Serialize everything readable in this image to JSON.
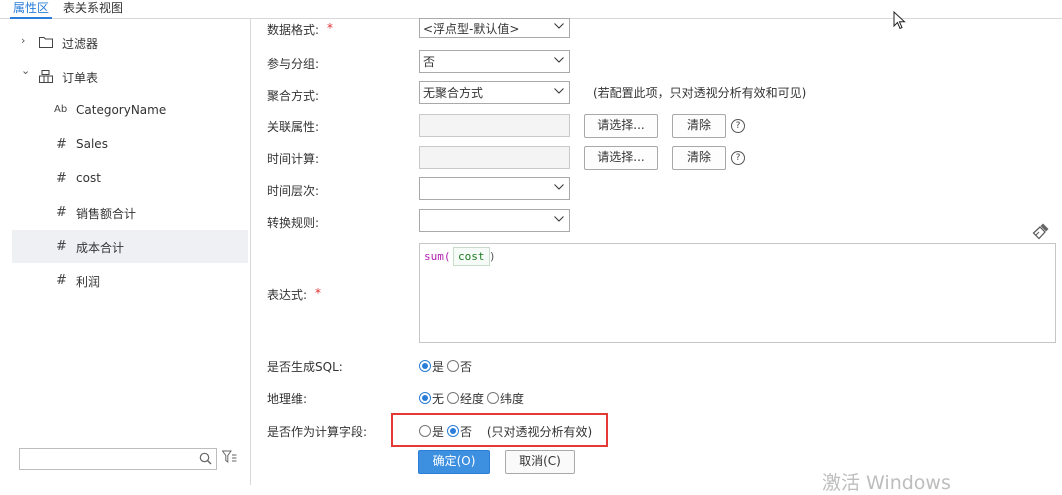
{
  "tabs": [
    {
      "label": "属性区",
      "active": true
    },
    {
      "label": "表关系视图",
      "active": false
    }
  ],
  "tree": {
    "items": [
      {
        "label": "过滤器",
        "icon": "folder-icon",
        "expander": "›"
      },
      {
        "label": "订单表",
        "icon": "table-icon",
        "expander": "⌄"
      },
      {
        "label": "CategoryName",
        "icon": "text-field-icon",
        "icon_glyph": "Ab"
      },
      {
        "label": "Sales",
        "icon": "number-field-icon",
        "icon_glyph": "#"
      },
      {
        "label": "cost",
        "icon": "number-field-icon",
        "icon_glyph": "#"
      },
      {
        "label": "销售额合计",
        "icon": "number-field-icon",
        "icon_glyph": "#"
      },
      {
        "label": "成本合计",
        "icon": "number-field-icon",
        "icon_glyph": "#",
        "selected": true
      },
      {
        "label": "利润",
        "icon": "number-field-icon",
        "icon_glyph": "#"
      }
    ],
    "search": {
      "value": "",
      "placeholder": ""
    }
  },
  "form": {
    "data_format": {
      "label": "数据格式:",
      "value": "<浮点型-默认值>"
    },
    "group": {
      "label": "参与分组:",
      "value": "否"
    },
    "aggregation": {
      "label": "聚合方式:",
      "value": "无聚合方式",
      "note": "(若配置此项，只对透视分析有效和可见)"
    },
    "related_attr": {
      "label": "关联属性:",
      "choose": "请选择...",
      "clear": "清除",
      "help": "?"
    },
    "time_calc": {
      "label": "时间计算:",
      "choose": "请选择...",
      "clear": "清除",
      "help": "?"
    },
    "time_level": {
      "label": "时间层次:",
      "value": ""
    },
    "conversion": {
      "label": "转换规则:",
      "value": ""
    },
    "expression": {
      "label": "表达式:",
      "required": "*",
      "fn": "sum(",
      "arg": "cost",
      "close": ")"
    },
    "gen_sql": {
      "label": "是否生成SQL:",
      "options": [
        "是",
        "否"
      ],
      "selected": 0
    },
    "geo": {
      "label": "地理维:",
      "options": [
        "无",
        "经度",
        "纬度"
      ],
      "selected": 0
    },
    "calc_field": {
      "label": "是否作为计算字段:",
      "options": [
        "是",
        "否"
      ],
      "selected": 1,
      "note": "(只对透视分析有效)"
    }
  },
  "buttons": {
    "ok": "确定(O)",
    "cancel": "取消(C)"
  },
  "watermark": "激活 Windows",
  "colors": {
    "accent": "#2a7dd8",
    "highlight": "#e53935",
    "primary_button": "#3d8fe0"
  }
}
